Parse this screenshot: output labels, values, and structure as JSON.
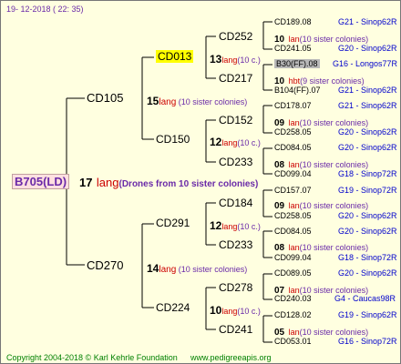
{
  "header": {
    "date": "19- 12-2018 ( 22: 35)"
  },
  "footer": {
    "copyright": "Copyright 2004-2018 © Karl Kehrle Foundation",
    "site": "www.pedigreeapis.org"
  },
  "root": {
    "id": "B705(LD)",
    "num": "17",
    "lang": "lang",
    "drones": "(Drones from 10 sister colonies)"
  },
  "gen1": [
    {
      "id": "CD105",
      "num": "15",
      "lang": "lang",
      "sis": " (10 sister colonies)"
    },
    {
      "id": "CD270",
      "num": "14",
      "lang": "lang",
      "sis": " (10 sister colonies)"
    }
  ],
  "gen2": [
    {
      "id": "CD013",
      "num": "13",
      "lang": "lang",
      "sis": "(10 c.)"
    },
    {
      "id": "CD150",
      "num": "12",
      "lang": "lang",
      "sis": "(10 c.)"
    },
    {
      "id": "CD291",
      "num": "12",
      "lang": "lang",
      "sis": "(10 c.)"
    },
    {
      "id": "CD224",
      "num": "10",
      "lang": "lang",
      "sis": "(10 c.)"
    }
  ],
  "gen3": [
    {
      "id": "CD252",
      "num": "10",
      "lang": "lan",
      "sis": "(10 sister colonies)"
    },
    {
      "id": "CD217",
      "num": "10",
      "lang": "hbt",
      "sis": "(9 sister colonies)"
    },
    {
      "id": "CD152",
      "num": "09",
      "lang": "lan",
      "sis": "(10 sister colonies)"
    },
    {
      "id": "CD233",
      "num": "08",
      "lang": "lan",
      "sis": "(10 sister colonies)"
    },
    {
      "id": "CD184",
      "num": "09",
      "lang": "lan",
      "sis": "(10 sister colonies)"
    },
    {
      "id": "CD233",
      "num": "08",
      "lang": "lan",
      "sis": "(10 sister colonies)"
    },
    {
      "id": "CD278",
      "num": "07",
      "lang": "lan",
      "sis": "(10 sister colonies)"
    },
    {
      "id": "CD241",
      "num": "05",
      "lang": "lan",
      "sis": "(10 sister colonies)"
    }
  ],
  "gen4": [
    {
      "id": "CD189.08",
      "breed": "G21 - Sinop62R"
    },
    {
      "id": "CD241.05",
      "breed": "G20 - Sinop62R"
    },
    {
      "id": "B30(FF).08",
      "breed": "G16 - Longos77R"
    },
    {
      "id": "B104(FF).07",
      "breed": "G21 - Sinop62R"
    },
    {
      "id": "CD178.07",
      "breed": "G21 - Sinop62R"
    },
    {
      "id": "CD258.05",
      "breed": "G20 - Sinop62R"
    },
    {
      "id": "CD084.05",
      "breed": "G20 - Sinop62R"
    },
    {
      "id": "CD099.04",
      "breed": "G18 - Sinop72R"
    },
    {
      "id": "CD157.07",
      "breed": "G19 - Sinop72R"
    },
    {
      "id": "CD258.05",
      "breed": "G20 - Sinop62R"
    },
    {
      "id": "CD084.05",
      "breed": "G20 - Sinop62R"
    },
    {
      "id": "CD099.04",
      "breed": "G18 - Sinop72R"
    },
    {
      "id": "CD089.05",
      "breed": "G20 - Sinop62R"
    },
    {
      "id": "CD240.03",
      "breed": "G4 - Caucas98R"
    },
    {
      "id": "CD128.02",
      "breed": "G19 - Sinop62R"
    },
    {
      "id": "CD053.01",
      "breed": "G16 - Sinop72R"
    }
  ]
}
